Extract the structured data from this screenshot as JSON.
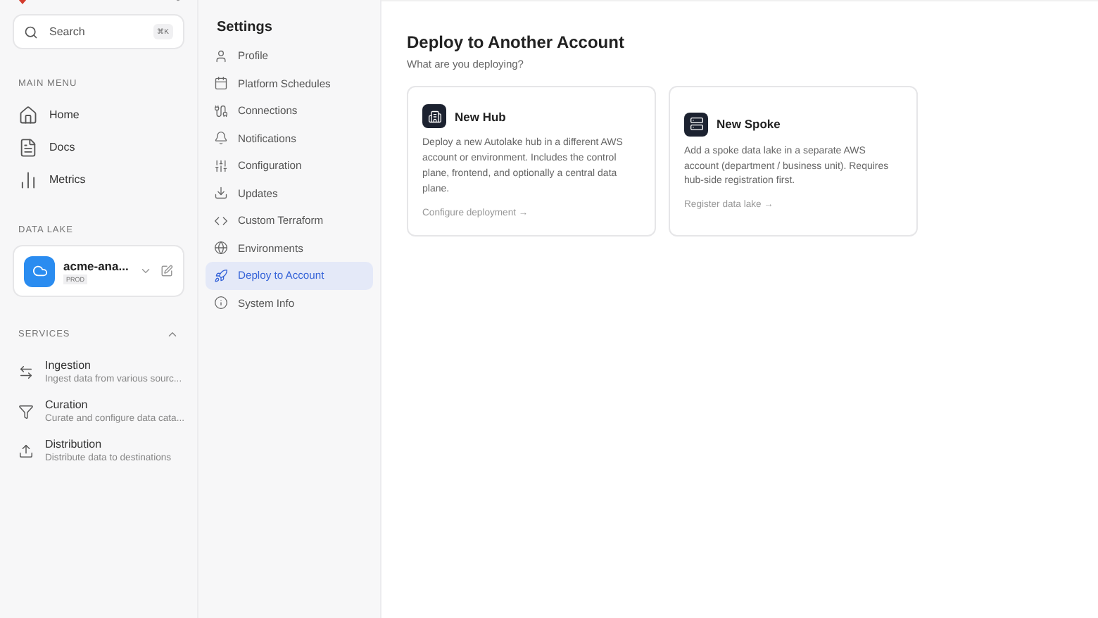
{
  "sidebar": {
    "search": {
      "placeholder": "Search",
      "shortcut": "⌘K"
    },
    "main_menu": {
      "title": "MAIN MENU",
      "items": [
        {
          "label": "Home",
          "kind": "home"
        },
        {
          "label": "Docs",
          "kind": "docs"
        },
        {
          "label": "Metrics",
          "kind": "metrics"
        }
      ]
    },
    "data_lake": {
      "title": "DATA LAKE",
      "name": "acme-ana...",
      "badge": "PROD"
    },
    "services": {
      "title": "SERVICES",
      "expanded": true,
      "items": [
        {
          "label": "Ingestion",
          "description": "Ingest data from various sourc...",
          "kind": "ingestion"
        },
        {
          "label": "Curation",
          "description": "Curate and configure data cata...",
          "kind": "curation"
        },
        {
          "label": "Distribution",
          "description": "Distribute data to destinations",
          "kind": "distribution"
        }
      ]
    }
  },
  "settings": {
    "title": "Settings",
    "items": [
      {
        "label": "Profile",
        "kind": "user",
        "selected": false
      },
      {
        "label": "Platform Schedules",
        "kind": "calendar",
        "selected": false
      },
      {
        "label": "Connections",
        "kind": "connections",
        "selected": false
      },
      {
        "label": "Notifications",
        "kind": "bell",
        "selected": false
      },
      {
        "label": "Configuration",
        "kind": "sliders",
        "selected": false
      },
      {
        "label": "Updates",
        "kind": "download",
        "selected": false
      },
      {
        "label": "Custom Terraform",
        "kind": "code",
        "selected": false
      },
      {
        "label": "Environments",
        "kind": "globe",
        "selected": false
      },
      {
        "label": "Deploy to Account",
        "kind": "rocket",
        "selected": true
      },
      {
        "label": "System Info",
        "kind": "info",
        "selected": false
      }
    ]
  },
  "main": {
    "title": "Deploy to Another Account",
    "subtitle": "What are you deploying?",
    "cards": [
      {
        "title": "New Hub",
        "kind": "building",
        "description": "Deploy a new Autolake hub in a different AWS account or environment. Includes the control plane, frontend, and optionally a central data plane.",
        "link": "Configure deployment →"
      },
      {
        "title": "New Spoke",
        "kind": "server",
        "description": "Add a spoke data lake in a separate AWS account (department / business unit). Requires hub-side registration first.",
        "link": "Register data lake →"
      }
    ]
  }
}
